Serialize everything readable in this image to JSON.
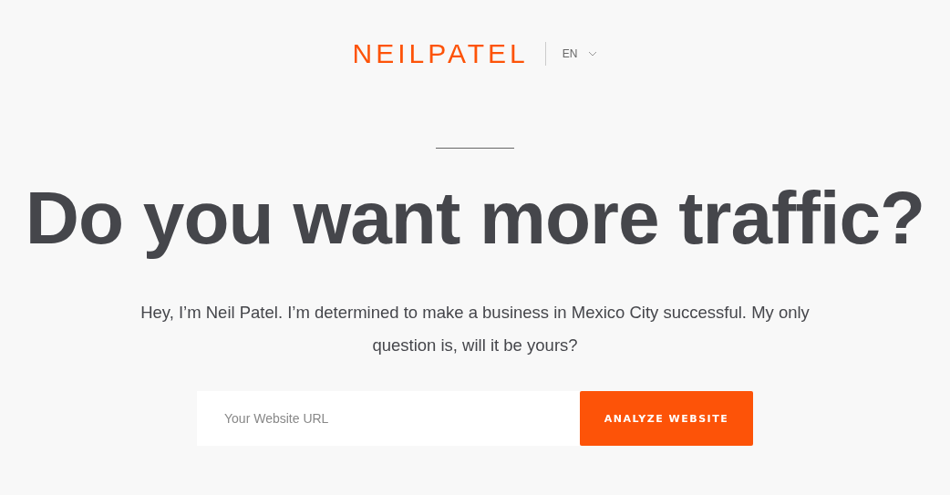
{
  "header": {
    "logo": "NEILPATEL",
    "language": "EN"
  },
  "hero": {
    "title": "Do you want more traffic?",
    "subtitle": "Hey, I’m Neil Patel. I’m determined to make a business in Mexico City successful. My only question is, will it be yours?"
  },
  "form": {
    "url_field": {
      "placeholder": "Your Website URL"
    },
    "button": "ANALYZE WEBSITE"
  }
}
